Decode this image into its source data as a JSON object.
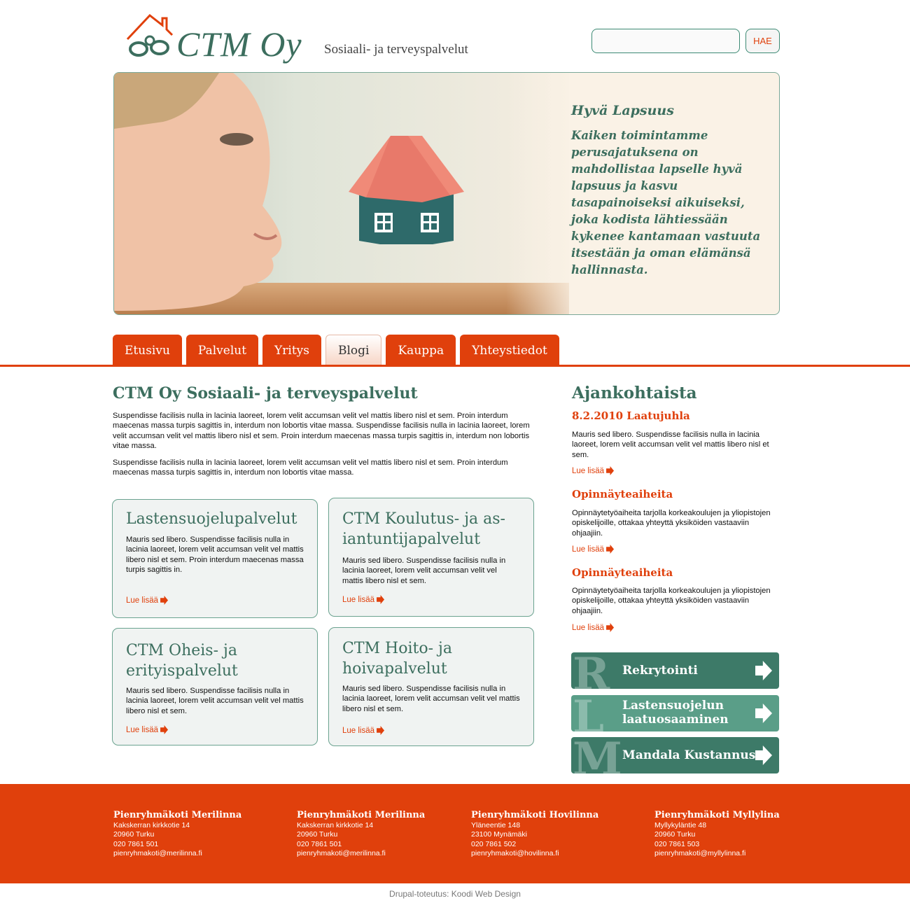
{
  "header": {
    "logo_text": "CTM Oy",
    "tagline": "Sosiaali- ja terveyspalvelut",
    "search": {
      "value": "",
      "placeholder": "",
      "button_label": "HAE"
    }
  },
  "hero": {
    "heading": "Hyvä Lapsuus",
    "text": "Kaiken toimintamme perusajatuksena on mahdollistaa lapselle hyvä lapsuus ja kasvu tasapainoiseksi aikuiseksi, joka kodista lähtiessään kykenee kantamaan vastuuta itsestään ja oman elämänsä hallinnasta."
  },
  "nav": {
    "items": [
      {
        "label": "Etusivu",
        "active": false
      },
      {
        "label": "Palvelut",
        "active": false
      },
      {
        "label": "Yritys",
        "active": false
      },
      {
        "label": "Blogi",
        "active": true
      },
      {
        "label": "Kauppa",
        "active": false
      },
      {
        "label": "Yhteystiedot",
        "active": false
      }
    ]
  },
  "main": {
    "title": "CTM Oy Sosiaali- ja terveyspalvelut",
    "paragraphs": [
      "Suspendisse facilisis nulla in lacinia laoreet, lorem velit accumsan velit vel mattis libero nisl et sem. Proin interdum maecenas massa turpis sagittis in, interdum non lobortis vitae massa. Suspendisse facilisis nulla in lacinia laoreet, lorem velit accumsan velit vel mattis libero nisl et sem. Proin interdum maecenas massa turpis sagittis in, interdum non lobortis vitae massa.",
      "Suspendisse facilisis nulla in lacinia laoreet, lorem velit accumsan velit vel mattis libero nisl et sem. Proin interdum maecenas massa turpis sagittis in, interdum non lobortis vitae massa."
    ],
    "boxes": [
      {
        "title": "Lastensuojelupalvelut",
        "text": "Mauris sed libero. Suspendisse facilisis nulla in lacinia laoreet, lorem velit accumsan velit vel mattis libero nisl et sem. Proin interdum maecenas massa turpis sagittis in.",
        "more": "Lue lisää"
      },
      {
        "title": "CTM Koulutus- ja as-iantuntijapalvelut",
        "text": "Mauris sed libero. Suspendisse facilisis nulla in lacinia laoreet, lorem velit accumsan velit vel mattis libero nisl et sem.",
        "more": "Lue lisää"
      },
      {
        "title": "CTM Oheis- ja erityispalvelut",
        "text": "Mauris sed libero. Suspendisse facilisis nulla in lacinia laoreet, lorem velit accumsan velit vel mattis libero nisl et sem.",
        "more": "Lue lisää"
      },
      {
        "title": "CTM Hoito- ja hoivapalvelut",
        "text": "Mauris sed libero. Suspendisse facilisis nulla in lacinia laoreet, lorem velit accumsan velit vel mattis libero nisl et sem.",
        "more": "Lue lisää"
      }
    ]
  },
  "sidebar": {
    "title": "Ajankohtaista",
    "news": [
      {
        "title": "8.2.2010 Laatujuhla",
        "text": "Mauris sed libero. Suspendisse facilisis nulla in lacinia laoreet, lorem velit accumsan velit vel mattis libero nisl et sem.",
        "more": "Lue lisää"
      },
      {
        "title": "Opinnäyteaiheita",
        "text": "Opinnäytetyöaiheita tarjolla korkeakoulujen ja yliopistojen opiskelijoille, ottakaa yhteyttä yksiköiden vastaaviin ohjaajiin.",
        "more": "Lue lisää"
      },
      {
        "title": "Opinnäyteaiheita",
        "text": "Opinnäytetyöaiheita tarjolla korkeakoulujen ja yliopistojen opiskelijoille, ottakaa yhteyttä yksiköiden vastaaviin ohjaajiin.",
        "more": "Lue lisää"
      }
    ],
    "buttons": [
      {
        "letter": "R",
        "label": "Rekrytointi",
        "color": "#3d7a68"
      },
      {
        "letter": "L",
        "label": "Lastensuojelun laatuosaaminen",
        "color": "#5a9e88"
      },
      {
        "letter": "M",
        "label": "Mandala Kustannus",
        "color": "#3d7a68"
      }
    ]
  },
  "footer": {
    "columns": [
      {
        "name": "Pienryhmäkoti Merilinna",
        "lines": [
          "Kakskerran kirkkotie 14",
          "20960 Turku",
          "020 7861 501",
          "pienryhmakoti@merilinna.fi"
        ]
      },
      {
        "name": "Pienryhmäkoti Merilinna",
        "lines": [
          "Kakskerran kirkkotie 14",
          "20960 Turku",
          "020 7861 501",
          "pienryhmakoti@merilinna.fi"
        ]
      },
      {
        "name": "Pienryhmäkoti Hovilinna",
        "lines": [
          "Yläneentie 148",
          "23100 Mynämäki",
          "020 7861 502",
          "pienryhmakoti@hovilinna.fi"
        ]
      },
      {
        "name": "Pienryhmäkoti Myllylina",
        "lines": [
          "Myllykyläntie 48",
          "20960 Turku",
          "020 7861 503",
          "pienryhmakoti@myllylinna.fi"
        ]
      }
    ],
    "credit": "Drupal-toteutus: Koodi Web Design"
  },
  "colors": {
    "accent": "#e0400c",
    "brand_green": "#3c6e5e",
    "hero_bg": "#faf2e6"
  }
}
